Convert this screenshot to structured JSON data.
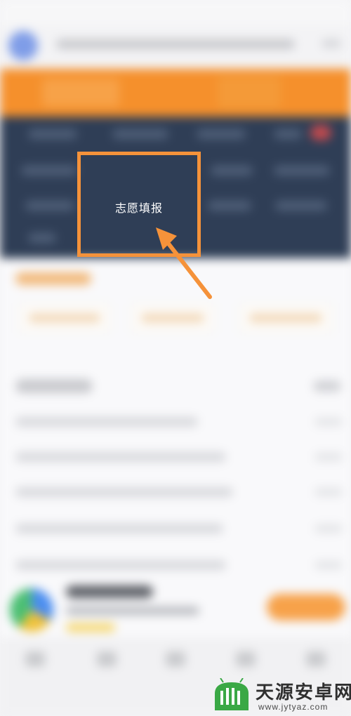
{
  "menu_item": {
    "label": "志愿填报"
  },
  "watermark": {
    "title": "天源安卓网",
    "url": "www.jytyaz.com",
    "logo_icon": "android-robot-icon"
  },
  "colors": {
    "accent_orange": "#f5923a",
    "navy_menu": "#2f3e56",
    "watermark_green": "#3aa845"
  }
}
